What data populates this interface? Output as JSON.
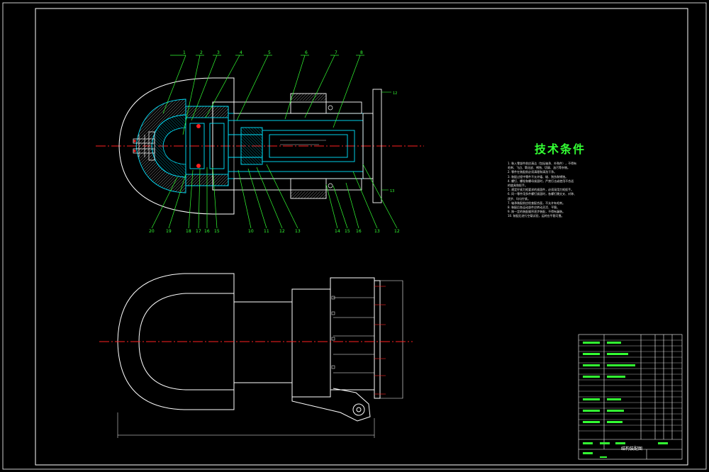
{
  "drawing": {
    "section_view_part_numbers_top": [
      "1",
      "2",
      "3",
      "4",
      "5",
      "6",
      "7",
      "8"
    ],
    "section_view_part_numbers_bottom": [
      "20",
      "19",
      "18",
      "17",
      "16",
      "15",
      "10",
      "11",
      "12",
      "13",
      "14",
      "15",
      "16",
      "13",
      "12"
    ],
    "right_callouts": [
      "12",
      "13"
    ]
  },
  "technical_requirements": {
    "title": "技术条件",
    "notes": [
      "1. 装入零部件前应清洁（包括轴承、外购件），不得有",
      "   毛刺、飞边、氧化皮、锈蚀、切屑、油污等杂物。",
      "2. 零件在装配前必须清理和清洗干净。",
      "3. 装配过程中零件不允许磕、碰、划伤和锈蚀。",
      "4. 螺钉、螺栓和螺母紧固时，严禁打击或使用不合适",
      "   的旋具和扳手。",
      "5. 规定拧紧力矩要求的紧固件，必须采用力矩扳手。",
      "6. 同一零件用多件螺钉紧固时，各螺钉需交叉、对称、",
      "   逐步、均匀拧紧。",
      "7. 轴承装配前应检查配合面，不允许有毛刺。",
      "8. 装配后各运动部件应转动灵活、平稳。",
      "9. 按一定的装配顺序逐步装配，不得有漏装。",
      "10. 装配后进行空载试验，运转应平稳可靠。"
    ]
  },
  "title_block": {
    "name": "结构装配图"
  },
  "colors": {
    "background": "#000000",
    "outline": "#ffffff",
    "section": "#00e5ff",
    "leader": "#33ff33",
    "centerline": "#ff2020",
    "hatch": "#ffffff"
  }
}
